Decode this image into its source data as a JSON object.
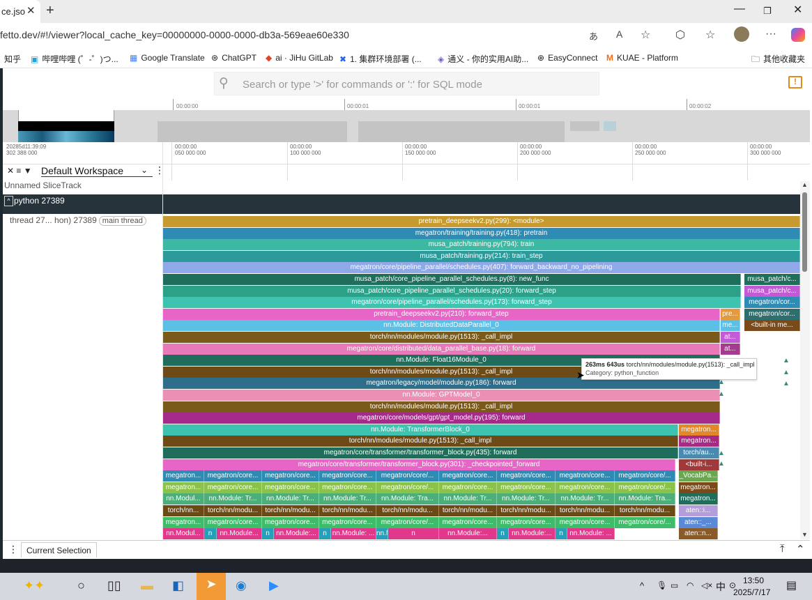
{
  "browser": {
    "tab_title": "ce.jso",
    "url": "fetto.dev/#!/viewer?local_cache_key=00000000-0000-0000-db3a-569eae60e330",
    "address_icons": [
      "read-aloud-icon",
      "translate-icon",
      "favorite-star-icon",
      "extensions-icon",
      "favorites-icon",
      "profile-avatar",
      "more-icon",
      "copilot-icon"
    ],
    "bookmarks": [
      {
        "label": "知乎",
        "icon": "zhihu-icon"
      },
      {
        "label": "哔哩哔哩 (゜-゜)つ...",
        "icon": "bilibili-icon"
      },
      {
        "label": "Google Translate",
        "icon": "google-translate-icon"
      },
      {
        "label": "ChatGPT",
        "icon": "chatgpt-icon"
      },
      {
        "label": "ai · JiHu GitLab",
        "icon": "gitlab-icon"
      },
      {
        "label": "1. 集群环境部署 (...",
        "icon": "confluence-icon"
      },
      {
        "label": "通义 - 你的实用AI助...",
        "icon": "tongyi-icon"
      },
      {
        "label": "EasyConnect",
        "icon": "globe-icon"
      },
      {
        "label": "KUAE - Platform",
        "icon": "kuae-icon"
      },
      {
        "label": "其他收藏夹",
        "icon": "folder-icon"
      }
    ]
  },
  "search": {
    "placeholder": "Search or type '>' for commands or ':' for SQL mode"
  },
  "overview": {
    "labels": [
      "00:00:00",
      "00:00:01",
      "00:00:01",
      "00:00:02"
    ]
  },
  "ruler": {
    "origin": [
      "20285d11:39:09",
      "302 388 000"
    ],
    "ticks": [
      [
        "00:00:00",
        "000 000 000"
      ],
      [
        "00:00:00",
        "050 000 000"
      ],
      [
        "00:00:00",
        "100 000 000"
      ],
      [
        "00:00:00",
        "150 000 000"
      ],
      [
        "00:00:00",
        "200 000 000"
      ],
      [
        "00:00:00",
        "250 000 000"
      ],
      [
        "00:00:00",
        "300 000 000"
      ]
    ]
  },
  "workspace": {
    "name": "Default Workspace"
  },
  "tracks": {
    "unnamed": "Unnamed SliceTrack",
    "process": "python 27389",
    "thread": "thread 27... hon) 27389",
    "thread_chip": "main thread"
  },
  "slices": {
    "main": [
      {
        "label": "pretrain_deepseekv2.py(299): <module>",
        "color": "#c79a2f"
      },
      {
        "label": "megatron/training/training.py(418): pretrain",
        "color": "#2e8bb4"
      },
      {
        "label": "musa_patch/training.py(794): train",
        "color": "#3db8a3"
      },
      {
        "label": "musa_patch/training.py(214): train_step",
        "color": "#2c9a9a"
      },
      {
        "label": "megatron/core/pipeline_parallel/schedules.py(407): forward_backward_no_pipelining",
        "color": "#8ea8e8"
      },
      {
        "label": "musa_patch/core_pipeline_parallel_schedules.py(8): new_func",
        "color": "#1f6e5c"
      },
      {
        "label": "musa_patch/core_pipeline_parallel_schedules.py(20): forward_step",
        "color": "#2fa088"
      },
      {
        "label": "megatron/core/pipeline_parallel/schedules.py(173): forward_step",
        "color": "#3ec3b0"
      },
      {
        "label": "pretrain_deepseekv2.py(210): forward_step",
        "color": "#e865c8"
      },
      {
        "label": "nn.Module: DistributedDataParallel_0",
        "color": "#5bbfe6"
      },
      {
        "label": "torch/nn/modules/module.py(1513): _call_impl",
        "color": "#7a5a1a"
      },
      {
        "label": "megatron/core/distributed/data_parallel_base.py(18): forward",
        "color": "#e879b8"
      },
      {
        "label": "nn.Module: Float16Module_0",
        "color": "#1f6e5c"
      },
      {
        "label": "torch/nn/modules/module.py(1513): _call_impl",
        "color": "#6e4a16"
      },
      {
        "label": "megatron/legacy/model/module.py(186): forward",
        "color": "#2e6e8a"
      },
      {
        "label": "nn.Module: GPTModel_0",
        "color": "#ec8fb5"
      },
      {
        "label": "torch/nn/modules/module.py(1513): _call_impl",
        "color": "#7a5a1a"
      },
      {
        "label": "megatron/core/models/gpt/gpt_model.py(195): forward",
        "color": "#a52a8a"
      },
      {
        "label": "nn.Module: TransformerBlock_0",
        "color": "#3ec3b0"
      },
      {
        "label": "torch/nn/modules/module.py(1513): _call_impl",
        "color": "#6e4a16"
      },
      {
        "label": "megatron/core/transformer/transformer_block.py(435): forward",
        "color": "#1f6e5c"
      },
      {
        "label": "megatron/core/transformer/transformer_block.py(301): _checkpointed_forward",
        "color": "#e865c8"
      }
    ],
    "right_col": [
      "pre...",
      "me...",
      "at...",
      "at..."
    ],
    "right_col2": [
      "megatron...",
      "megatron...",
      "torch/au...",
      "<built-i..."
    ],
    "far_right": [
      "musa_patch/c...",
      "musa_patch/c...",
      "megatron/cor...",
      "megatron/cor...",
      "<built-in me..."
    ],
    "row22": [
      "megatron...",
      "megatron/core...",
      "megatron/core...",
      "megatron/core...",
      "megatron/core/...",
      "megatron/core...",
      "megatron/core...",
      "megatron/core...",
      "megatron/core/..."
    ],
    "row23": [
      "megatron...",
      "megatron/core...",
      "megatron/core...",
      "megatron/core...",
      "megatron/core/...",
      "megatron/core...",
      "megatron/core...",
      "megatron/core...",
      "megatron/core/..."
    ],
    "row24": [
      "nn.Modul...",
      "nn.Module: Tr...",
      "nn.Module: Tr...",
      "nn.Module: Tr...",
      "nn.Module: Tra...",
      "nn.Module: Tr...",
      "nn.Module: Tr...",
      "nn.Module: Tr...",
      "nn.Module: Tra..."
    ],
    "row25": [
      "torch/nn...",
      "torch/nn/modu...",
      "torch/nn/modu...",
      "torch/nn/modu...",
      "torch/nn/modu...",
      "torch/nn/modu...",
      "torch/nn/modu...",
      "torch/nn/modu...",
      "torch/nn/modu..."
    ],
    "row26": [
      "megatron...",
      "megatron/core...",
      "megatron/core...",
      "megatron/core...",
      "megatron/core/...",
      "megatron/core...",
      "megatron/core...",
      "megatron/core...",
      "megatron/core/..."
    ],
    "row27": [
      "nn.Modul...",
      "n",
      "nn.Module...",
      "n",
      "nn.Module:...",
      "n",
      "nn.Module: ...",
      "nn.Module:...",
      "n",
      "nn.Module:...",
      "n",
      "nn.Module:...",
      "n",
      "nn.Module: ..."
    ],
    "right_stack": [
      "_VocabPa...",
      "megatron...",
      "megatron...",
      "aten::i...",
      "aten::_...",
      "aten::n..."
    ]
  },
  "tooltip": {
    "duration": "263ms 643us",
    "name": "torch/nn/modules/module.py(1513): _call_impl",
    "category": "Category: python_function"
  },
  "bottom": {
    "tab": "Current Selection"
  },
  "taskbar": {
    "time": "13:50",
    "date": "2025/7/17",
    "ime": "中"
  }
}
